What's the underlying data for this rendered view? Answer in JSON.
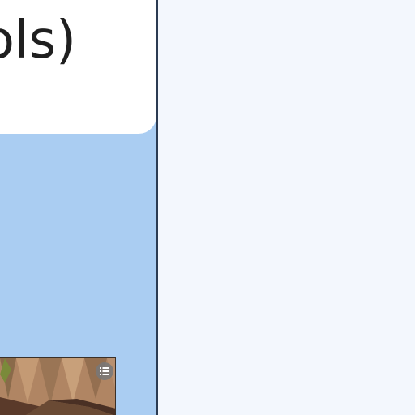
{
  "card": {
    "title": "ols)"
  },
  "thumbnail": {
    "button_icon": "list-icon"
  },
  "colors": {
    "left_panel": "#aacdf2",
    "right_panel": "#f3f7fd",
    "divider": "#2b3b52",
    "card": "#ffffff"
  }
}
